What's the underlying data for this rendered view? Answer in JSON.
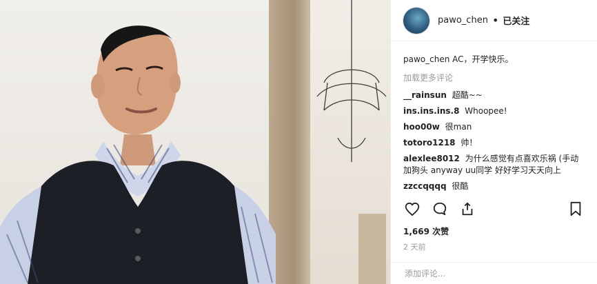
{
  "post": {
    "username": "pawo_chen",
    "follow_status": "已关注",
    "caption": "pawo_chen AC，开学快乐。",
    "load_more": "加载更多评论",
    "comments": [
      {
        "user": "__rainsun",
        "text": "超酷~~"
      },
      {
        "user": "ins.ins.ins.8",
        "text": "Whoopee!"
      },
      {
        "user": "hoo00w",
        "text": "很man"
      },
      {
        "user": "totoro1218",
        "text": "帅！"
      },
      {
        "user": "alexlee8012",
        "text": "为什么感觉有点喜欢乐祸 (手动加狗头 anyway uu同学 好好学习天天向上"
      },
      {
        "user": "zzccqqqq",
        "text": "很酷"
      }
    ],
    "likes": "1,669 次赞",
    "time": "2 天前",
    "add_comment_placeholder": "添加评论..."
  },
  "icons": {
    "like": "heart-icon",
    "comment": "comment-icon",
    "share": "share-icon",
    "bookmark": "bookmark-icon"
  }
}
